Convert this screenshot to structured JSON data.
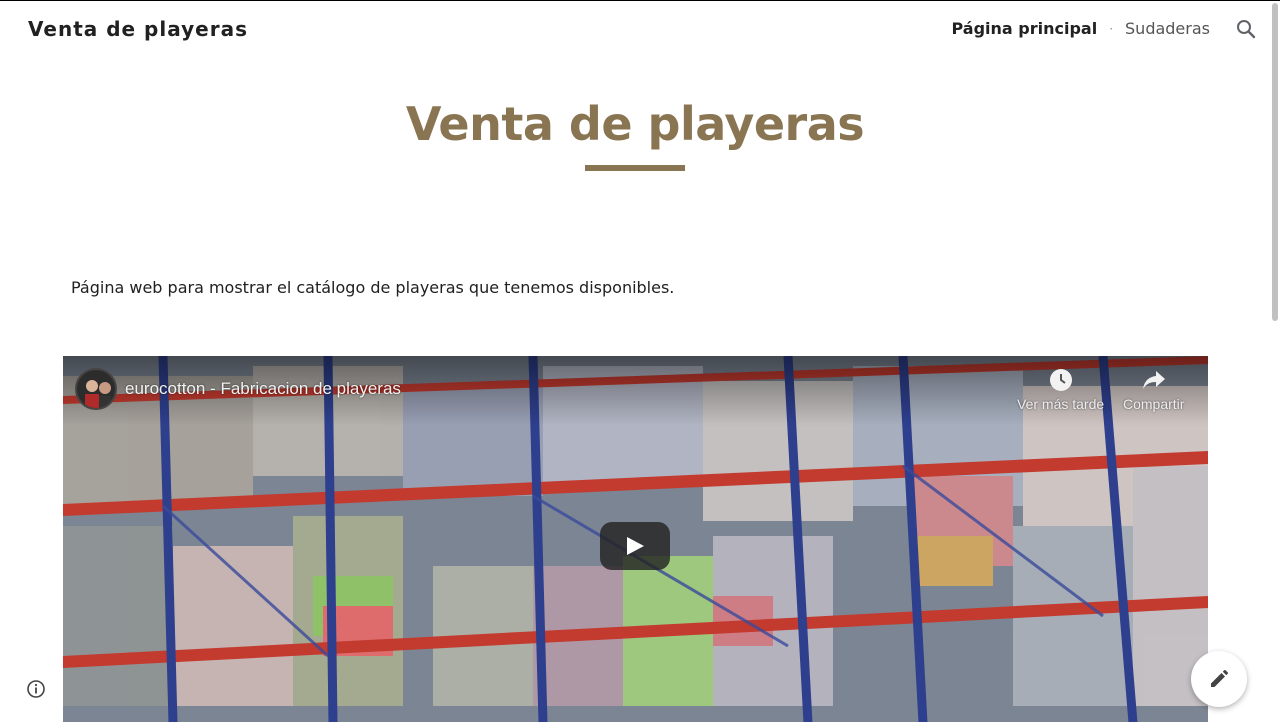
{
  "header": {
    "site_title": "Venta de playeras",
    "nav": [
      {
        "label": "Página principal",
        "active": true
      },
      {
        "label": "Sudaderas",
        "active": false
      }
    ],
    "search_icon": "search-icon"
  },
  "hero": {
    "title": "Venta de playeras",
    "accent_color": "#8a7552"
  },
  "main": {
    "description": "Página web para mostrar el catálogo de playeras que tenemos disponibles."
  },
  "video": {
    "title": "eurocotton - Fabricacion de playeras",
    "watch_later_label": "Ver más tarde",
    "share_label": "Compartir",
    "icons": [
      "clock-icon",
      "share-icon",
      "play-icon"
    ]
  },
  "footer": {
    "info_icon": "info-icon",
    "edit_icon": "pencil-icon"
  }
}
